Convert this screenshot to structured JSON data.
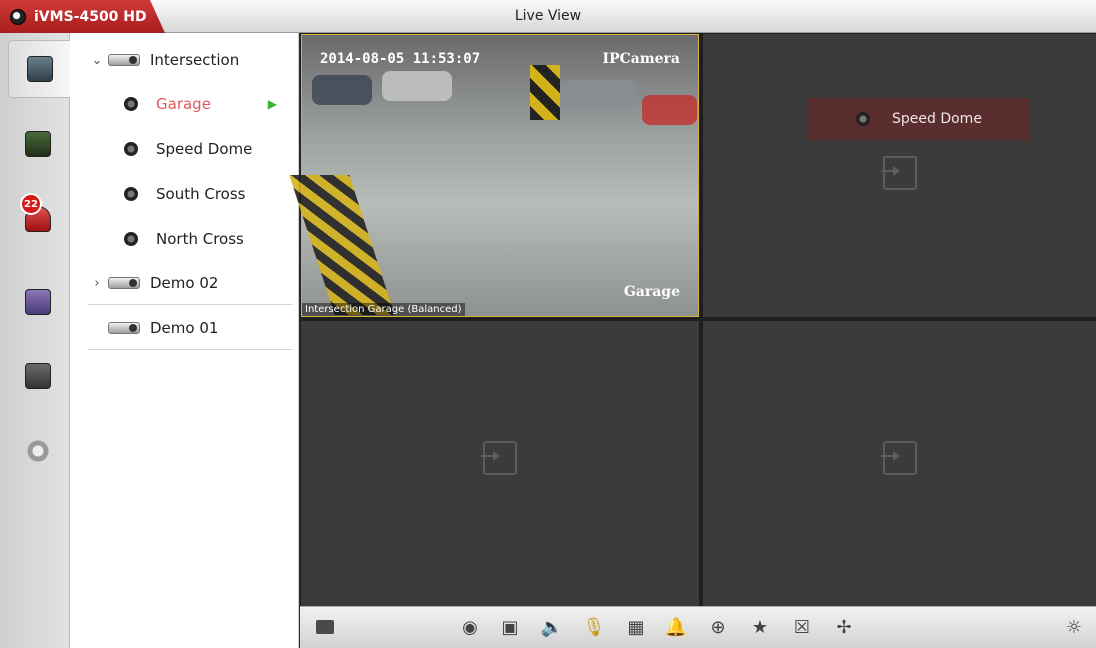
{
  "app": {
    "name": "iVMS-4500 HD",
    "window_title": "Live View"
  },
  "nav": {
    "alarm_count": "22"
  },
  "tree": {
    "items": [
      {
        "label": "Intersection",
        "type": "device",
        "expanded": true
      },
      {
        "label": "Garage",
        "type": "camera",
        "selected": true
      },
      {
        "label": "Speed Dome",
        "type": "camera"
      },
      {
        "label": "South Cross",
        "type": "camera"
      },
      {
        "label": "North Cross",
        "type": "camera"
      },
      {
        "label": "Demo 02",
        "type": "device",
        "expanded": false
      },
      {
        "label": "Demo 01",
        "type": "device"
      }
    ]
  },
  "video": {
    "pane1": {
      "timestamp": "2014-08-05 11:53:07",
      "camera_tag": "IPCamera",
      "osd_name": "Garage",
      "status": "Intersection Garage (Balanced)"
    },
    "pane2": {
      "label": "Speed Dome"
    }
  },
  "toolbar": {
    "icons": [
      "layout-icon",
      "snapshot-icon",
      "record-icon",
      "audio-icon",
      "talk-icon",
      "quality-icon",
      "alarm-output-icon",
      "zoom-icon",
      "favorite-icon",
      "close-all-icon",
      "fullscreen-icon",
      "ptz-icon"
    ]
  },
  "colors": {
    "accent": "#c62828",
    "selected_text": "#e05a5a",
    "pane_bg": "#3b3b3b"
  }
}
